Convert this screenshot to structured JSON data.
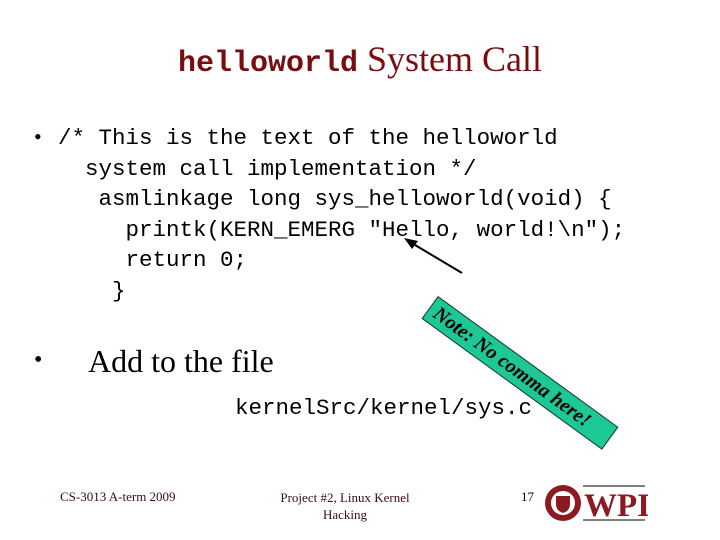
{
  "slide": {
    "title_mono": "helloworld",
    "title_rest": " System Call",
    "bullets": [
      {
        "code_lines": [
          "/* This is the text of the helloworld",
          "system call implementation */",
          " asmlinkage long sys_helloworld(void) {",
          "   printk(KERN_EMERG \"Hello, world!\\n\");",
          "   return 0;",
          "  }"
        ]
      },
      {
        "text": "Add to the file",
        "path": "kernelSrc/kernel/sys.c"
      }
    ],
    "note": "Note: No comma here!",
    "colors": {
      "title": "#7a0c10",
      "note_bg": "#1ec796",
      "brand": "#8b1a22"
    }
  },
  "footer": {
    "course": "CS-3013 A-term 2009",
    "project": "Project #2, Linux Kernel Hacking",
    "page_number": "17",
    "logo_text": "WPI"
  }
}
